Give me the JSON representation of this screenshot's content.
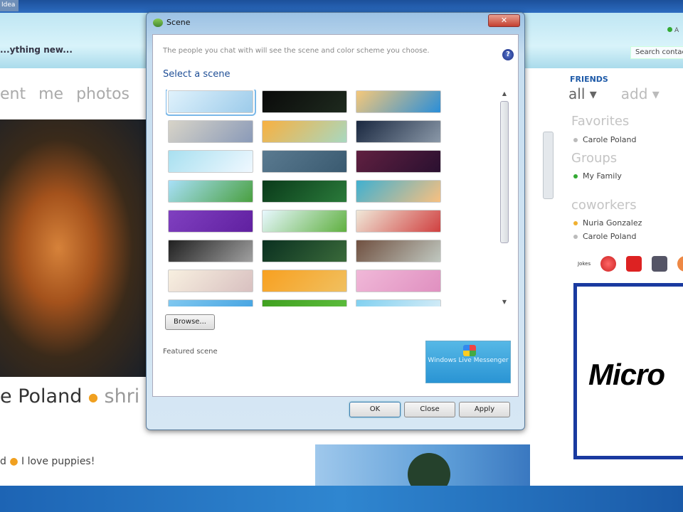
{
  "taskbar": {
    "tab_label": "Idea"
  },
  "messenger": {
    "status_text": "...ything new...",
    "nav": [
      "ent",
      "me",
      "photos"
    ],
    "profile_name": "e Poland",
    "profile_sub": "shri",
    "mood_name": "d",
    "mood_text": "I love puppies!",
    "online_label": "A",
    "search_placeholder": "Search contacts",
    "friends_heading": "FRIENDS",
    "friends_tabs": [
      "all ▾",
      "add ▾"
    ],
    "groups": [
      {
        "name": "Favorites",
        "contacts": [
          {
            "name": "Carole Poland",
            "status": "#bbbbbb"
          }
        ]
      },
      {
        "name": "Groups",
        "contacts": [
          {
            "name": "My Family",
            "status": "#33aa33"
          }
        ]
      },
      {
        "name": "coworkers",
        "contacts": [
          {
            "name": "Nuria Gonzalez",
            "status": "#f0b030"
          },
          {
            "name": "Carole Poland",
            "status": "#bbbbbb"
          }
        ]
      }
    ],
    "emoticon_label": "Jokes",
    "ad_text": "Micro"
  },
  "dialog": {
    "title": "Scene",
    "close_glyph": "✕",
    "description": "The people you chat with will see the scene and color scheme you choose.",
    "help_glyph": "?",
    "select_heading": "Select a scene",
    "scenes": [
      [
        "#e0f2fc",
        "#9ccbea"
      ],
      [
        "#0a0a0a",
        "#1e2a1e"
      ],
      [
        "#f5c87a",
        "#2a8ed8"
      ],
      [
        "#d8d4c8",
        "#8a9ab8"
      ],
      [
        "#f8b040",
        "#a8d8c0"
      ],
      [
        "#1a2840",
        "#8a98a8"
      ],
      [
        "#a8e0f0",
        "#f0f8ff"
      ],
      [
        "#5a7a90",
        "#3a5a70"
      ],
      [
        "#602040",
        "#2a1030"
      ],
      [
        "#a8e0f8",
        "#4aa040"
      ],
      [
        "#0a3a1a",
        "#2a7a3a"
      ],
      [
        "#40b0d0",
        "#f8c080"
      ],
      [
        "#8040c0",
        "#6020a0"
      ],
      [
        "#e8f8ff",
        "#60b040"
      ],
      [
        "#f0e8d8",
        "#d04040"
      ],
      [
        "#202020",
        "#a0a0a0"
      ],
      [
        "#0a3020",
        "#3a6a3a"
      ],
      [
        "#705040",
        "#c0c8c0"
      ],
      [
        "#f8f0e0",
        "#d8c0c0"
      ],
      [
        "#f8a020",
        "#f0c060"
      ],
      [
        "#f0b8d8",
        "#e090c0"
      ],
      [
        "#80c8f0",
        "#40a0e0"
      ],
      [
        "#40a020",
        "#60c040"
      ],
      [
        "#80d0f0",
        "#e0f0f8"
      ]
    ],
    "selected_index": 0,
    "browse_label": "Browse...",
    "featured_label": "Featured scene",
    "featured_text": "Windows Live Messenger",
    "ok_label": "OK",
    "close_label": "Close",
    "apply_label": "Apply"
  }
}
